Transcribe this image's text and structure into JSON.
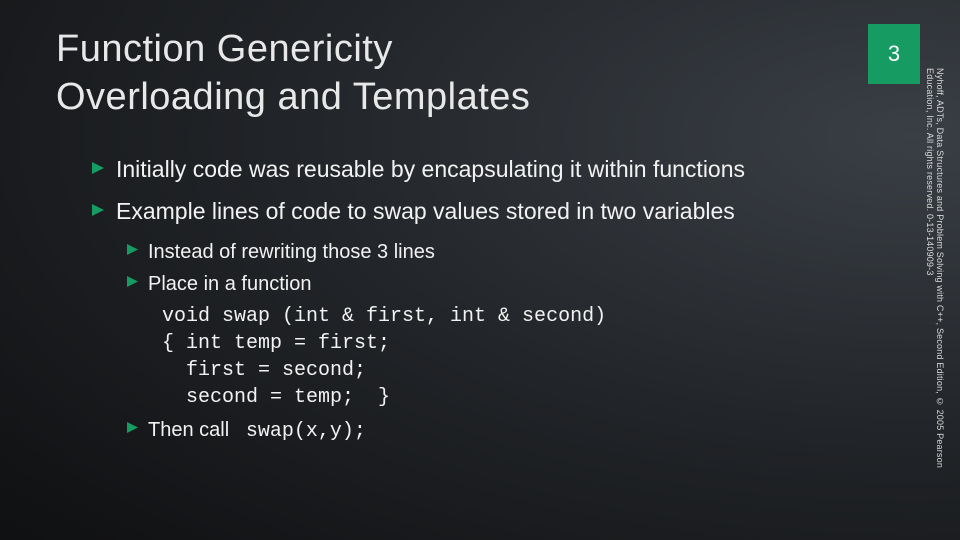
{
  "page_number": "3",
  "title_line1": "Function Genericity",
  "title_line2": "Overloading and Templates",
  "bullets": {
    "b1a": "Initially code was reusable by encapsulating it within functions",
    "b1b": "Example lines of code to swap values stored in two variables",
    "b2a": "Instead of rewriting those 3 lines",
    "b2b_lead": "Place in a function",
    "b2c_lead": "Then call"
  },
  "code": {
    "swap_def": "void swap (int & first, int & second)\n{ int temp = first;\n  first = second;\n  second = temp;  }",
    "swap_call": "swap(x,y);"
  },
  "footer_citation": "Nyhoff, ADTs, Data Structures and Problem Solving with C++, Second Edition, © 2005 Pearson Education, Inc. All rights reserved. 0-13-140909-3",
  "colors": {
    "accent": "#169b62"
  }
}
